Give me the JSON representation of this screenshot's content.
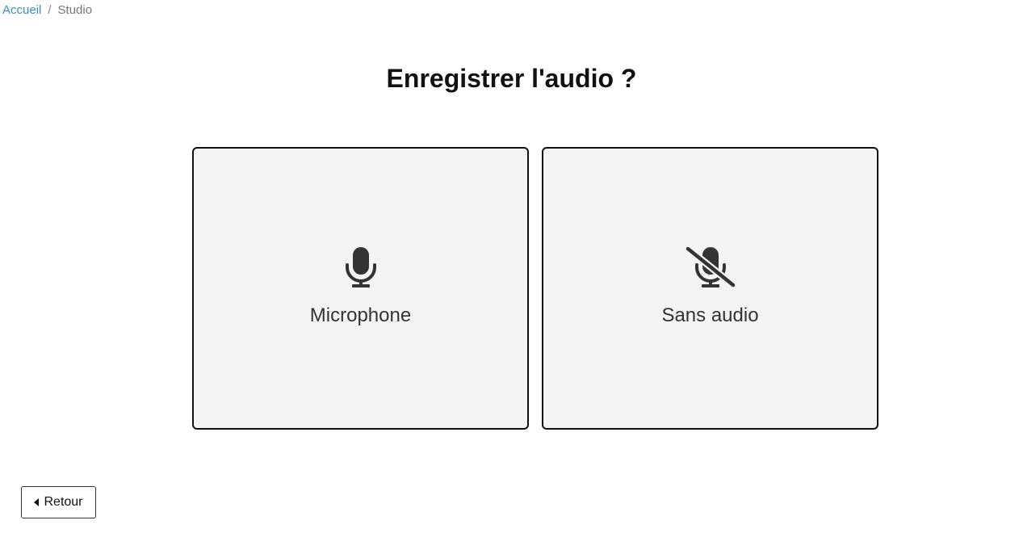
{
  "breadcrumb": {
    "home": "Accueil",
    "separator": "/",
    "current": "Studio"
  },
  "page": {
    "title": "Enregistrer l'audio ?"
  },
  "options": {
    "microphone": {
      "label": "Microphone",
      "icon": "microphone-icon"
    },
    "no_audio": {
      "label": "Sans audio",
      "icon": "microphone-slash-icon"
    }
  },
  "footer": {
    "back_label": "Retour",
    "back_icon": "caret-left-icon"
  },
  "colors": {
    "link": "#3a8fc0",
    "card_bg": "#f4f4f4",
    "card_border": "#111111",
    "icon": "#333333"
  }
}
